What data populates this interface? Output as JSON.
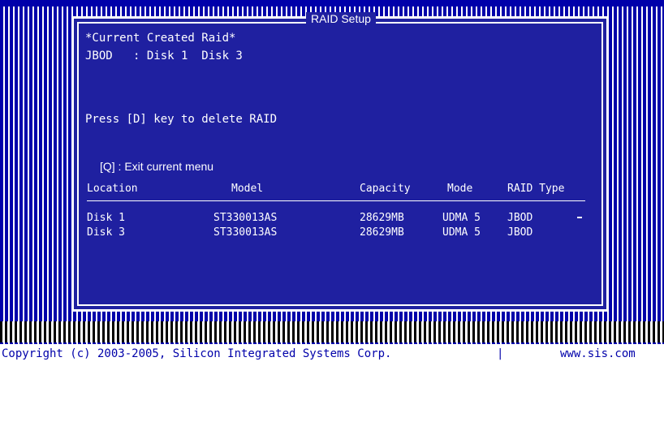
{
  "footer": {
    "copyright": "Copyright (c) 2003-2005, Silicon Integrated Systems Corp.",
    "separator": "|",
    "website": "www.sis.com"
  },
  "dialog": {
    "title": "RAID Setup",
    "section_header": "*Current Created Raid*",
    "created_summary": "JBOD   : Disk 1  Disk 3",
    "delete_hint": "Press [D] key to delete RAID",
    "exit_hint": "[Q] : Exit current menu"
  },
  "table": {
    "headers": [
      "Location",
      "Model",
      "Capacity",
      "Mode",
      "RAID Type"
    ],
    "rows": [
      [
        "Disk 1",
        "ST330013AS",
        "28629MB",
        "UDMA 5",
        "JBOD"
      ],
      [
        "Disk 3",
        "ST330013AS",
        "28629MB",
        "UDMA 5",
        "JBOD"
      ]
    ]
  }
}
